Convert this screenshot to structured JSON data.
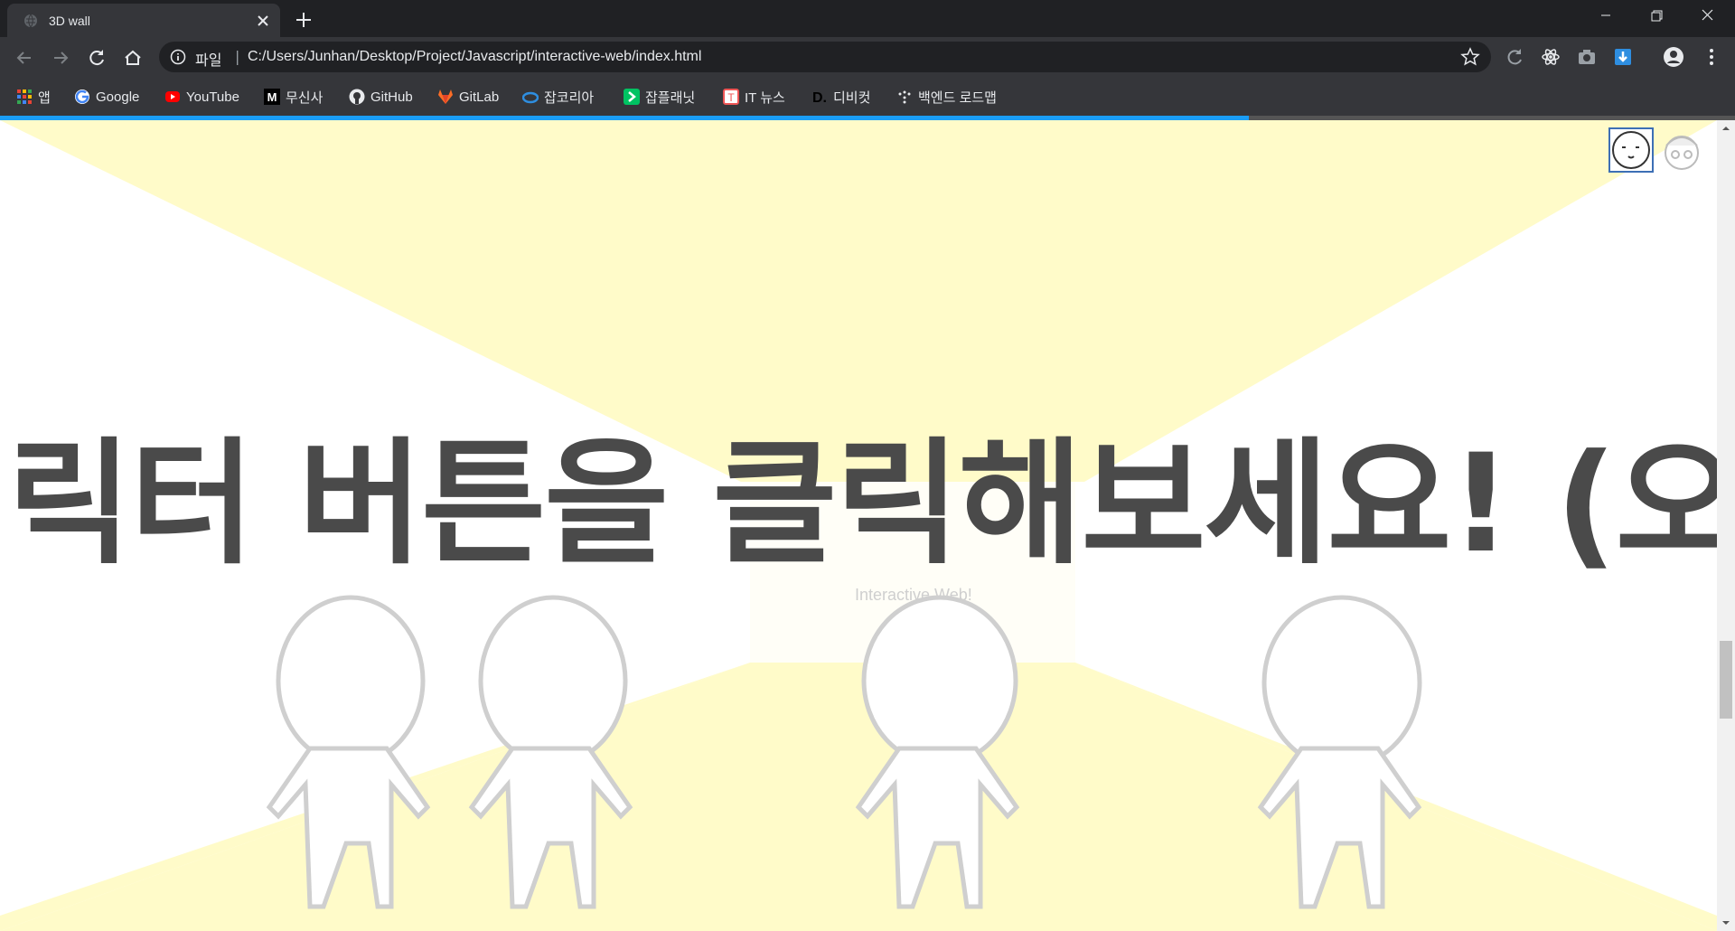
{
  "tab": {
    "title": "3D wall",
    "favicon": "globe-icon"
  },
  "window_controls": [
    "minimize-icon",
    "restore-icon",
    "close-icon"
  ],
  "address_bar": {
    "scheme_label": "파일",
    "url": "C:/Users/Junhan/Desktop/Project/Javascript/interactive-web/index.html"
  },
  "bookmarks": [
    {
      "label": "앱",
      "icon": "apps-grid-icon"
    },
    {
      "label": "Google",
      "icon": "google-icon"
    },
    {
      "label": "YouTube",
      "icon": "youtube-icon"
    },
    {
      "label": "무신사",
      "icon": "musinsa-icon"
    },
    {
      "label": "GitHub",
      "icon": "github-icon"
    },
    {
      "label": "GitLab",
      "icon": "gitlab-icon"
    },
    {
      "label": "잡코리아",
      "icon": "jobkorea-icon"
    },
    {
      "label": "잡플래닛",
      "icon": "jobplanet-icon"
    },
    {
      "label": "IT 뉴스",
      "icon": "it-news-icon"
    },
    {
      "label": "디비컷",
      "icon": "dbcut-icon"
    },
    {
      "label": "백엔드 로드맵",
      "icon": "roadmap-icon"
    }
  ],
  "page": {
    "load_progress": 0.72,
    "banner_text": "릭터 버튼을 클릭해보세요! (오른쪽",
    "stage_label": "Interactive Web!",
    "character_buttons": [
      {
        "name": "character-1",
        "selected": true
      },
      {
        "name": "character-2",
        "selected": false
      }
    ],
    "colors": {
      "wall": "#fffbc9",
      "text": "#4a4a4a",
      "progress": "#1a9df5"
    }
  }
}
